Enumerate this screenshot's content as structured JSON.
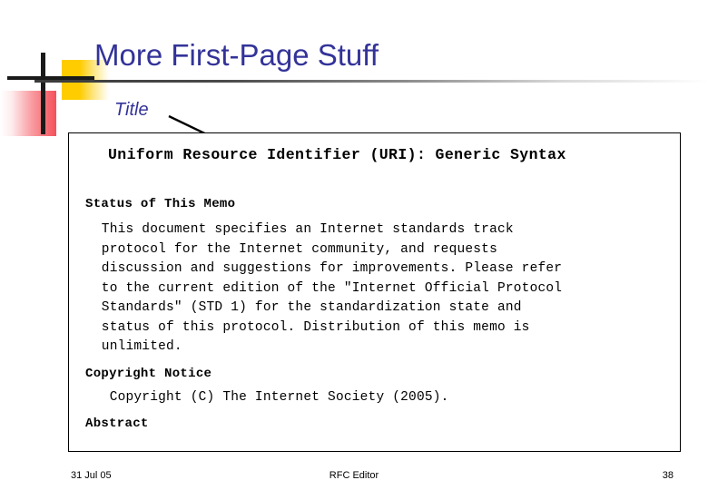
{
  "slide": {
    "title": "More First-Page Stuff",
    "annotation": "Title",
    "accent_color": "#333399",
    "decor_yellow": "#FFCC00",
    "decor_red": "#F4505A",
    "decor_bar": "#1A1A1A"
  },
  "rfc": {
    "doc_title": "Uniform Resource Identifier (URI): Generic Syntax",
    "status": {
      "heading": "Status of This Memo",
      "body": "  This document specifies an Internet standards track\n  protocol for the Internet community, and requests\n  discussion and suggestions for improvements. Please refer\n  to the current edition of the \"Internet Official Protocol\n  Standards\" (STD 1) for the standardization state and\n  status of this protocol. Distribution of this memo is\n  unlimited."
    },
    "copyright": {
      "heading": "Copyright Notice",
      "body": "   Copyright (C) The Internet Society (2005)."
    },
    "abstract": {
      "heading": "Abstract"
    }
  },
  "footer": {
    "date": "31 Jul 05",
    "center": "RFC Editor",
    "page_number": "38"
  }
}
